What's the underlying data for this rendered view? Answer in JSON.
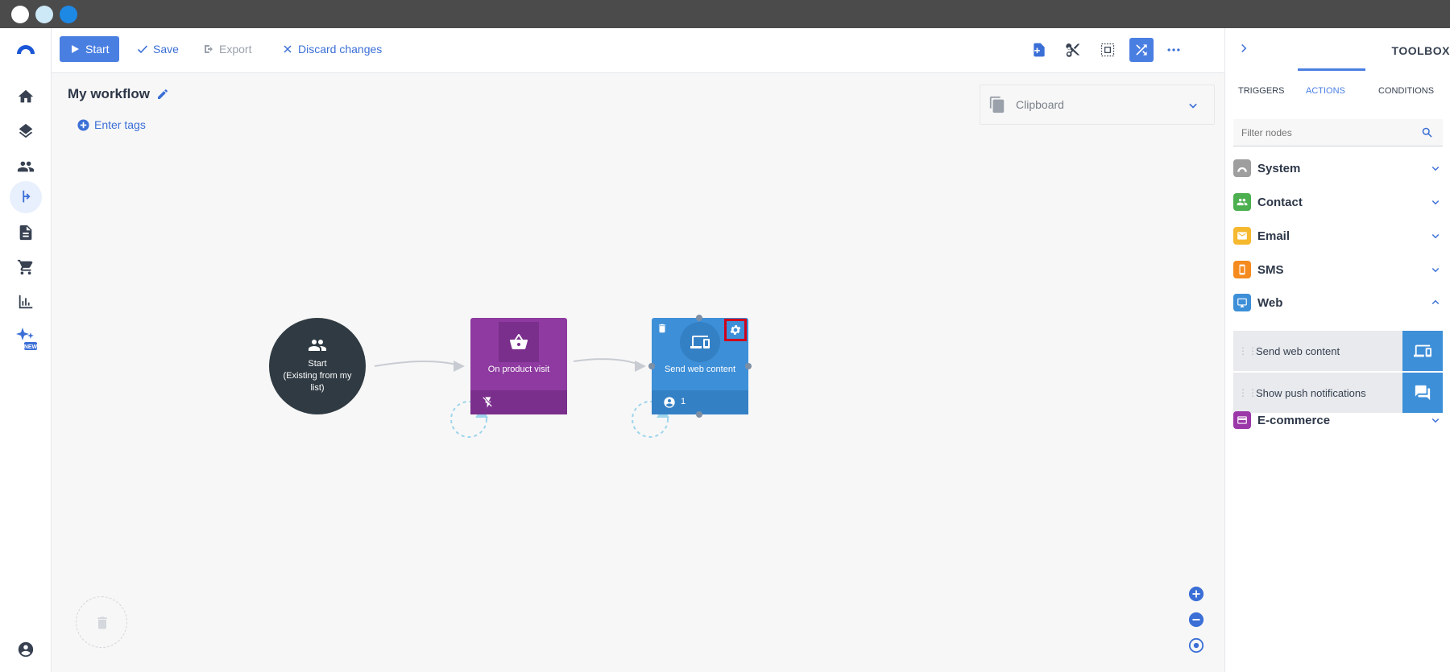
{
  "window": {
    "controls": [
      "close",
      "minimize",
      "maximize"
    ]
  },
  "toolbar": {
    "start_label": "Start",
    "save_label": "Save",
    "export_label": "Export",
    "discard_label": "Discard changes"
  },
  "workflow": {
    "title": "My workflow",
    "tags_label": "Enter tags",
    "clipboard_label": "Clipboard"
  },
  "nodes": {
    "start": {
      "title": "Start",
      "subtitle": "(Existing from my list)"
    },
    "product_visit": {
      "label": "On product visit"
    },
    "send_web": {
      "label": "Send web content",
      "count": "1"
    }
  },
  "toolbox": {
    "title": "TOOLBOX",
    "tabs": [
      "TRIGGERS",
      "ACTIONS",
      "CONDITIONS"
    ],
    "active_tab": "ACTIONS",
    "filter_placeholder": "Filter nodes",
    "categories": [
      {
        "label": "System",
        "color": "#9e9e9e",
        "icon": "system-icon"
      },
      {
        "label": "Contact",
        "color": "#4caf50",
        "icon": "contact-icon"
      },
      {
        "label": "Email",
        "color": "#f5b82e",
        "icon": "email-icon"
      },
      {
        "label": "SMS",
        "color": "#f58a1f",
        "icon": "sms-icon"
      },
      {
        "label": "Web",
        "color": "#3d8fd8",
        "icon": "web-icon",
        "expanded": true
      },
      {
        "label": "E-commerce",
        "color": "#9b37a8",
        "icon": "ecommerce-icon"
      }
    ],
    "web_items": [
      {
        "label": "Send web content",
        "icon": "devices-icon"
      },
      {
        "label": "Show push notifications",
        "icon": "chat-icon"
      }
    ]
  },
  "colors": {
    "accent": "#4a7fe2",
    "purple_node": "#8e3aa0",
    "blue_node": "#3d8fd8",
    "start_node": "#2f3a42",
    "highlight": "#d0021b"
  }
}
